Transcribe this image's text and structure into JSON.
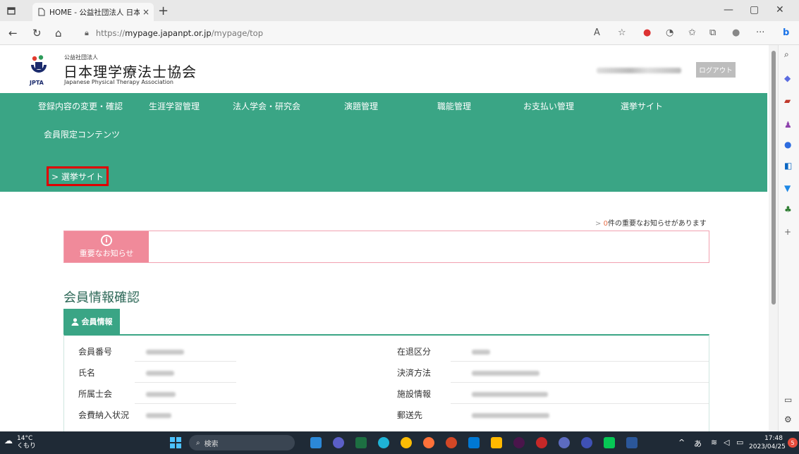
{
  "browser": {
    "tab_title": "HOME - 公益社団法人 日本理学",
    "tab_close": "×",
    "new_tab": "+",
    "url_prefix": "https://",
    "url_host": "mypage.japanpt.or.jp",
    "url_path": "/mypage/top",
    "read_aloud": "A",
    "more": "···"
  },
  "header": {
    "logo_corp": "公益社団法人",
    "logo_name": "日本理学療法士協会",
    "logo_abbr": "JPTA",
    "logo_en": "Japanese Physical Therapy Association",
    "logout_label": "ログアウト"
  },
  "nav": {
    "items": [
      "登録内容の変更・確認",
      "生涯学習管理",
      "法人学会・研究会",
      "演題管理",
      "職能管理",
      "お支払い管理",
      "選挙サイト",
      "会員限定コンテンツ"
    ],
    "sub_link": "> 選挙サイト"
  },
  "notices": {
    "chevron": ">",
    "count": "0",
    "suffix": "件の重要なお知らせがあります",
    "icon_glyph": "i",
    "tag_label": "重要なお知らせ"
  },
  "member": {
    "section_title": "会員情報確認",
    "tab_label": "会員情報",
    "rows_left": [
      "会員番号",
      "氏名",
      "所属士会",
      "会費納入状況"
    ],
    "rows_right": [
      "在退区分",
      "決済方法",
      "施設情報",
      "郵送先"
    ]
  },
  "taskbar": {
    "temp": "14°C",
    "weather": "くもり",
    "search_label": "検索",
    "ime": "あ",
    "time": "17:48",
    "date": "2023/04/25",
    "badge": "5"
  },
  "colors": {
    "brand_green": "#3aa585",
    "notice_pink": "#f08a9a",
    "highlight_red": "#e00000"
  }
}
